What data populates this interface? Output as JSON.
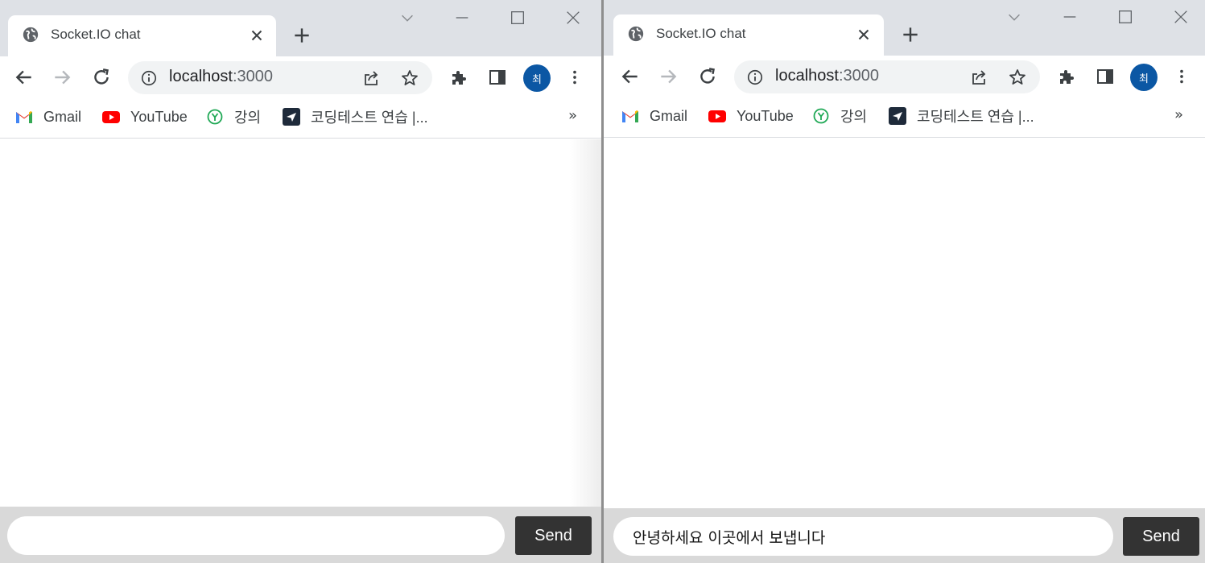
{
  "windows": [
    {
      "tab_title": "Socket.IO chat",
      "url_host": "localhost",
      "url_port": ":3000",
      "profile_initial": "최",
      "bookmarks": [
        {
          "label": "Gmail",
          "icon": "gmail-icon"
        },
        {
          "label": "YouTube",
          "icon": "youtube-icon"
        },
        {
          "label": "강의",
          "icon": "lecture-icon"
        },
        {
          "label": "코딩테스트 연습 |...",
          "icon": "programmers-icon"
        }
      ],
      "bookmarks_overflow": "»",
      "chat": {
        "input_value": "",
        "send_label": "Send"
      }
    },
    {
      "tab_title": "Socket.IO chat",
      "url_host": "localhost",
      "url_port": ":3000",
      "profile_initial": "최",
      "bookmarks": [
        {
          "label": "Gmail",
          "icon": "gmail-icon"
        },
        {
          "label": "YouTube",
          "icon": "youtube-icon"
        },
        {
          "label": "강의",
          "icon": "lecture-icon"
        },
        {
          "label": "코딩테스트 연습 |...",
          "icon": "programmers-icon"
        }
      ],
      "bookmarks_overflow": "»",
      "chat": {
        "input_value": "안녕하세요 이곳에서 보냅니다",
        "send_label": "Send"
      }
    }
  ],
  "colors": {
    "avatar": "#0b57a4",
    "send_button": "#333333",
    "form_bar": "#d9d9d9",
    "youtube_red": "#ff0000",
    "tabstrip": "#dee1e6"
  }
}
